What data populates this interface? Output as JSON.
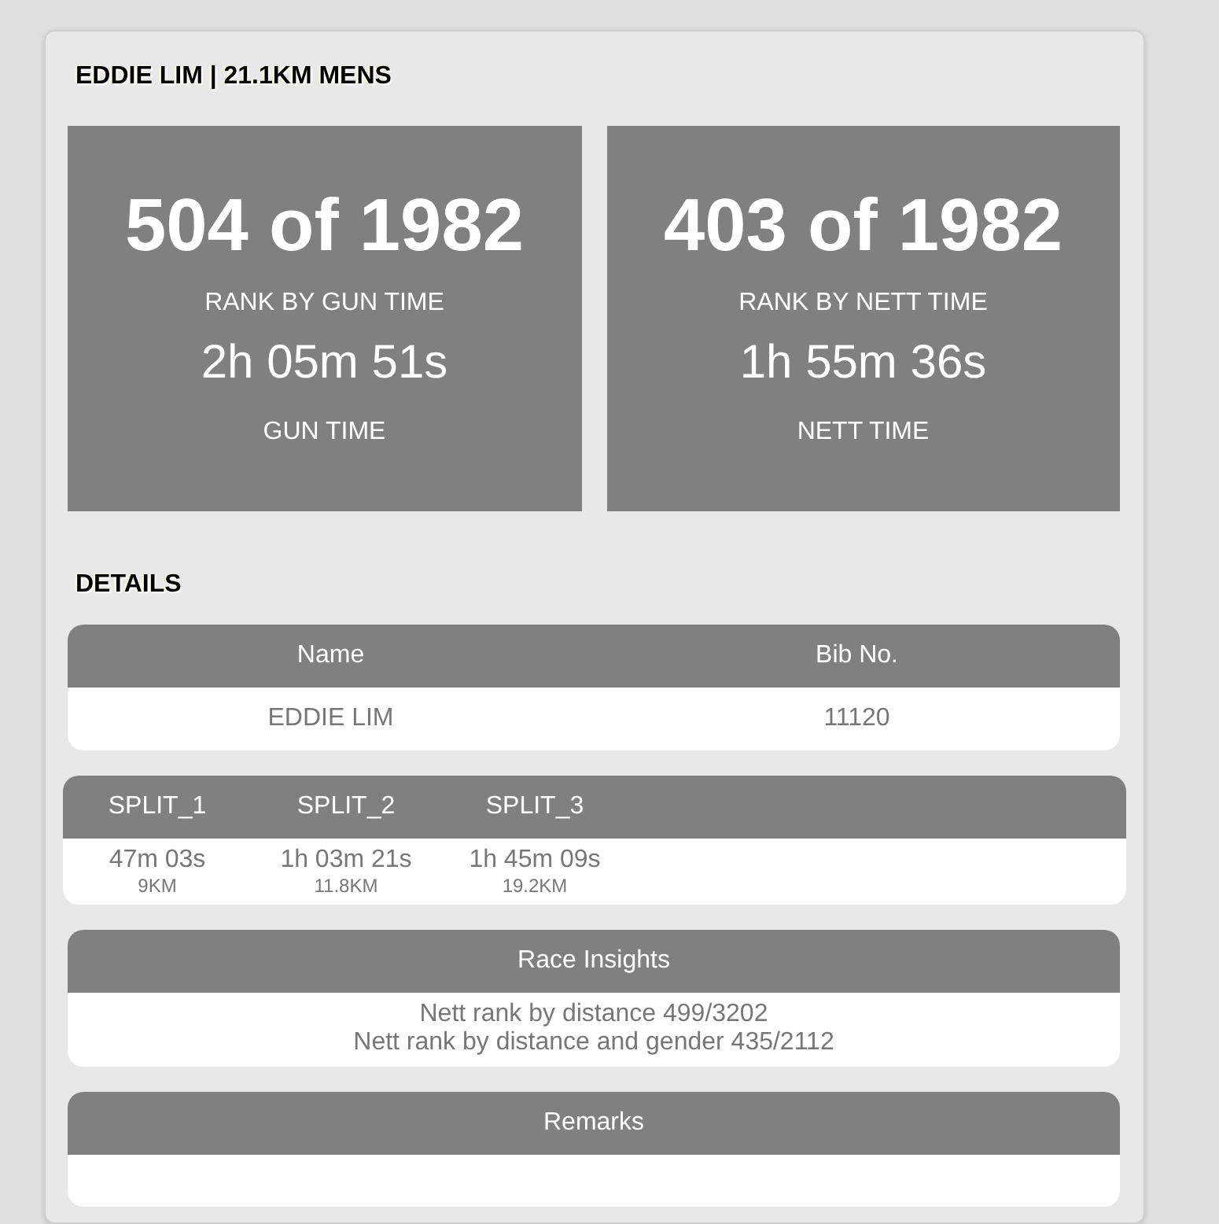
{
  "title": "EDDIE LIM | 21.1KM MENS",
  "stats": [
    {
      "rank": "504 of 1982",
      "rank_label": "RANK BY GUN TIME",
      "time": "2h 05m 51s",
      "time_label": "GUN TIME"
    },
    {
      "rank": "403 of 1982",
      "rank_label": "RANK BY NETT TIME",
      "time": "1h 55m 36s",
      "time_label": "NETT TIME"
    }
  ],
  "details_heading": "DETAILS",
  "info_table": {
    "columns": [
      "Name",
      "Bib No."
    ],
    "values": [
      "EDDIE LIM",
      "11120"
    ]
  },
  "splits": [
    {
      "label": "SPLIT_1",
      "time": "47m 03s",
      "distance": "9KM"
    },
    {
      "label": "SPLIT_2",
      "time": "1h 03m 21s",
      "distance": "11.8KM"
    },
    {
      "label": "SPLIT_3",
      "time": "1h 45m 09s",
      "distance": "19.2KM"
    }
  ],
  "insights": {
    "heading": "Race Insights",
    "lines": [
      "Nett rank by distance 499/3202",
      "Nett rank by distance and gender 435/2112"
    ]
  },
  "remarks": {
    "heading": "Remarks"
  }
}
